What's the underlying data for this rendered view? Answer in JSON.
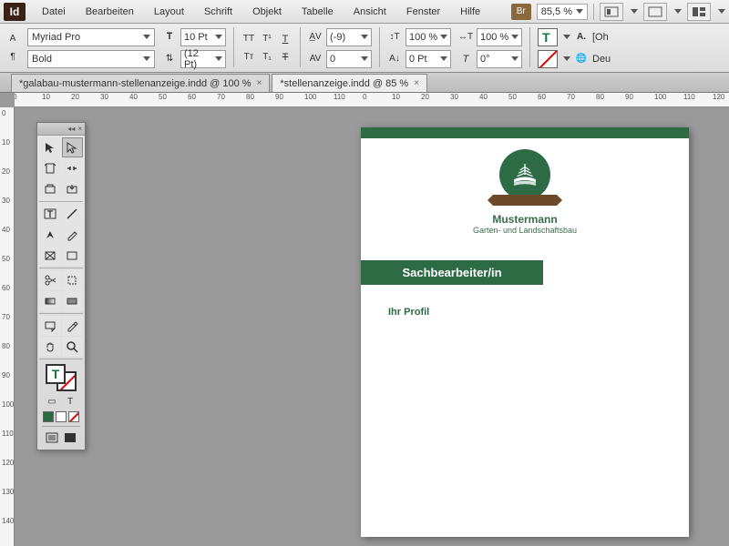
{
  "menu": {
    "items": [
      "Datei",
      "Bearbeiten",
      "Layout",
      "Schrift",
      "Objekt",
      "Tabelle",
      "Ansicht",
      "Fenster",
      "Hilfe"
    ],
    "br": "Br",
    "zoom": "85,5 %",
    "trunc": "[Oh",
    "lang": "Deu"
  },
  "ctrl": {
    "font": "Myriad Pro",
    "weight": "Bold",
    "size": "10 Pt",
    "leading": "(12 Pt)",
    "kerning": "(-9)",
    "tracking": "0",
    "hscale": "100 %",
    "vscale": "100 %",
    "baseline": "0 Pt",
    "skew": "0°"
  },
  "tabs": [
    {
      "label": "*galabau-mustermann-stellenanzeige.indd @ 100 %",
      "active": false
    },
    {
      "label": "*stellenanzeige.indd @ 85 %",
      "active": true
    }
  ],
  "ruler_h": [
    "0",
    "10",
    "20",
    "30",
    "40",
    "50",
    "60",
    "70",
    "80",
    "90",
    "100",
    "110",
    "0",
    "10",
    "20",
    "30",
    "40",
    "50",
    "60",
    "70",
    "80",
    "90",
    "100",
    "110",
    "120"
  ],
  "ruler_v": [
    "0",
    "10",
    "20",
    "30",
    "40",
    "50",
    "60",
    "70",
    "80",
    "90",
    "100",
    "110",
    "120",
    "130",
    "140"
  ],
  "doc": {
    "company": "Mustermann",
    "tagline": "Garten- und Landschaftsbau",
    "jobtitle": "Sachbearbeiter/in",
    "section": "Ihr Profil"
  },
  "tools": {
    "names": [
      "selection",
      "direct-selection",
      "page",
      "gap",
      "content-collector",
      "content-placer",
      "type",
      "line",
      "pen",
      "pencil",
      "rectangle-frame",
      "rectangle",
      "scissors",
      "free-transform",
      "gradient-swatch",
      "gradient-feather",
      "note",
      "eyedropper",
      "hand",
      "zoom"
    ]
  }
}
